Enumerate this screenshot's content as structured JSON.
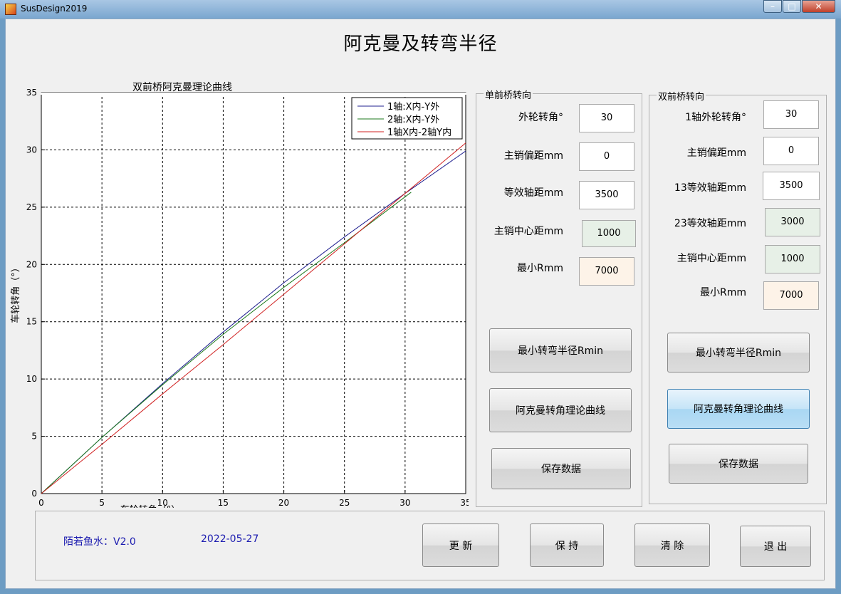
{
  "window": {
    "title": "SusDesign2019"
  },
  "header": {
    "title": "阿克曼及转弯半径"
  },
  "chart_data": {
    "type": "line",
    "title": "双前桥阿克曼理论曲线",
    "xlabel": "车轮转角（°）",
    "ylabel": "车轮转角（°）",
    "xlim": [
      0,
      35
    ],
    "ylim": [
      0,
      35
    ],
    "xticks": [
      0,
      5,
      10,
      15,
      20,
      25,
      30,
      35
    ],
    "yticks": [
      0,
      5,
      10,
      15,
      20,
      25,
      30,
      35
    ],
    "grid": true,
    "legend_position": "top-right",
    "series": [
      {
        "name": "1轴:X内-Y外",
        "color": "#1f1f8f",
        "x": [
          0,
          5,
          10,
          15,
          20,
          25,
          30,
          35
        ],
        "y": [
          0,
          4.9,
          9.6,
          14.1,
          18.4,
          22.4,
          26.2,
          29.9
        ]
      },
      {
        "name": "2轴:X内-Y外",
        "color": "#1c7a1c",
        "x": [
          0,
          5,
          10,
          15,
          20,
          25,
          30.5
        ],
        "y": [
          0,
          4.9,
          9.5,
          13.9,
          18.0,
          21.9,
          26.3
        ]
      },
      {
        "name": "1轴X内-2轴Y内",
        "color": "#d02020",
        "x": [
          0,
          5,
          10,
          15,
          20,
          25,
          30,
          35
        ],
        "y": [
          0,
          4.3,
          8.7,
          13.0,
          17.4,
          21.8,
          26.2,
          30.6
        ]
      }
    ]
  },
  "single": {
    "legend": "单前桥转向",
    "rows": [
      {
        "label": "外轮转角°",
        "value": "30"
      },
      {
        "label": "主销偏距mm",
        "value": "0"
      },
      {
        "label": "等效轴距mm",
        "value": "3500"
      },
      {
        "label": "主销中心距mm",
        "value": "1000"
      },
      {
        "label": "最小Rmm",
        "value": "7000"
      }
    ],
    "btn_rmin": "最小转弯半径Rmin",
    "btn_curve": "阿克曼转角理论曲线",
    "btn_save": "保存数据"
  },
  "double": {
    "legend": "双前桥转向",
    "rows": [
      {
        "label": "1轴外轮转角°",
        "value": "30"
      },
      {
        "label": "主销偏距mm",
        "value": "0"
      },
      {
        "label": "13等效轴距mm",
        "value": "3500"
      },
      {
        "label": "23等效轴距mm",
        "value": "3000"
      },
      {
        "label": "主销中心距mm",
        "value": "1000"
      },
      {
        "label": "最小Rmm",
        "value": "7000"
      }
    ],
    "btn_rmin": "最小转弯半径Rmin",
    "btn_curve": "阿克曼转角理论曲线",
    "btn_save": "保存数据"
  },
  "footer": {
    "author": "陌若鱼水：V2.0",
    "date": "2022-05-27",
    "btn_update": "更 新",
    "btn_hold": "保 持",
    "btn_clear": "清 除",
    "btn_exit": "退 出"
  },
  "colors": {
    "active_button": "#a9d7f3",
    "readonly_green": "#e7f0e7",
    "readonly_orange": "#fdf3e8",
    "footer_text": "#1c1cb0"
  }
}
